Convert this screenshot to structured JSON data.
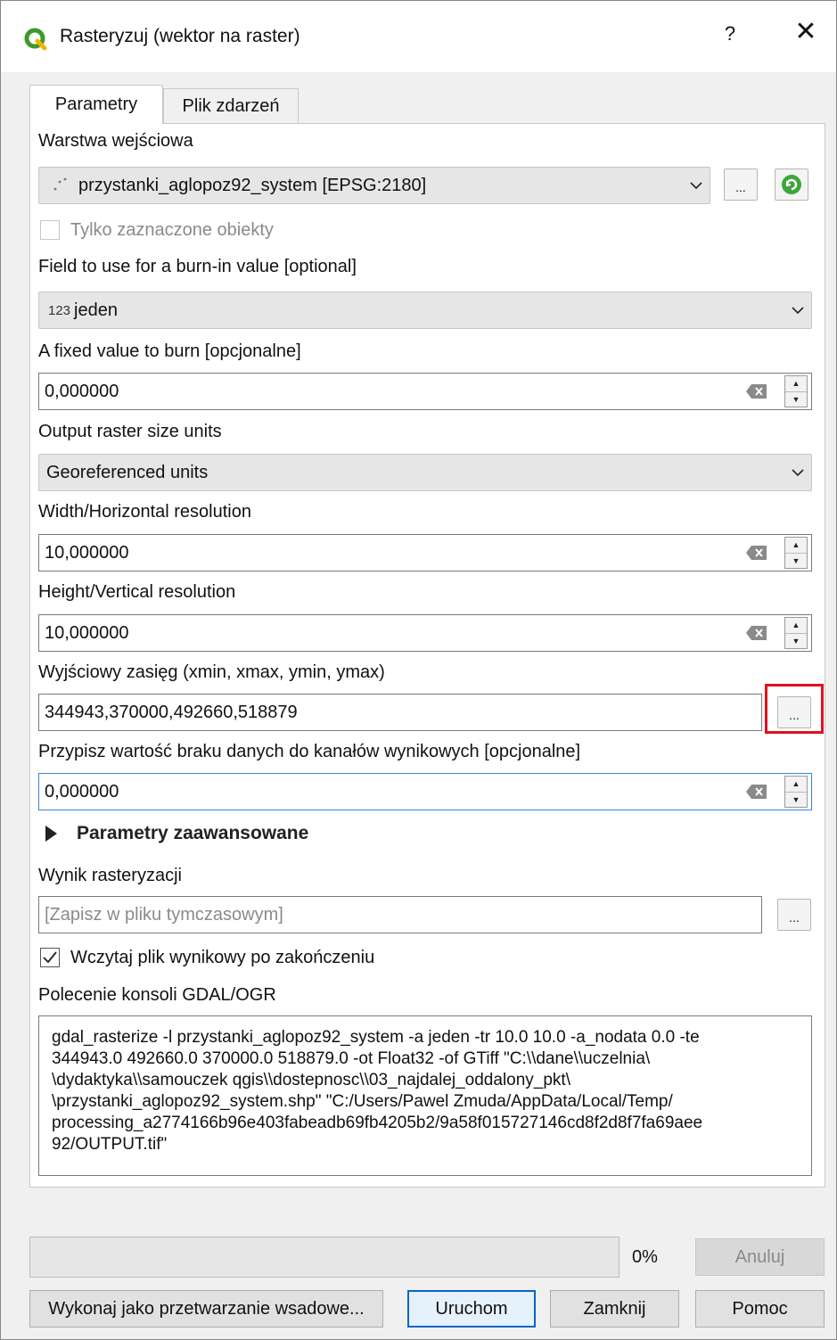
{
  "window": {
    "title": "Rasteryzuj (wektor na raster)",
    "help": "?",
    "close": "✕",
    "accent_color": "#3c9a2d"
  },
  "tabs": [
    {
      "label": "Parametry",
      "active": true
    },
    {
      "label": "Plik zdarzeń",
      "active": false
    }
  ],
  "input_layer": {
    "label": "Warstwa wejściowa",
    "value": "przystanki_aglopoz92_system [EPSG:2180]",
    "browse": "...",
    "selected_only_label": "Tylko zaznaczone obiekty",
    "selected_only_checked": false
  },
  "burn_field": {
    "label": "Field to use for a burn-in value [optional]",
    "type_prefix": "123",
    "value": "jeden"
  },
  "fixed_value": {
    "label": "A fixed value to burn [opcjonalne]",
    "value": "0,000000"
  },
  "size_units": {
    "label": "Output raster size units",
    "value": "Georeferenced units"
  },
  "width_res": {
    "label": "Width/Horizontal resolution",
    "value": "10,000000"
  },
  "height_res": {
    "label": "Height/Vertical resolution",
    "value": "10,000000"
  },
  "extent": {
    "label": "Wyjściowy zasięg (xmin, xmax, ymin, ymax)",
    "value": "344943,370000,492660,518879",
    "browse": "..."
  },
  "nodata": {
    "label": "Przypisz wartość braku danych do kanałów wynikowych [opcjonalne]",
    "value": "0,000000"
  },
  "advanced": {
    "label": "Parametry zaawansowane"
  },
  "output": {
    "label": "Wynik rasteryzacji",
    "placeholder": "[Zapisz w pliku tymczasowym]",
    "browse": "...",
    "open_label": "Wczytaj plik wynikowy po zakończeniu",
    "open_checked": true
  },
  "console": {
    "label": "Polecenie konsoli GDAL/OGR",
    "text": "gdal_rasterize -l przystanki_aglopoz92_system -a jeden -tr 10.0 10.0 -a_nodata 0.0 -te\n344943.0 492660.0 370000.0 518879.0 -ot Float32 -of GTiff \"C:\\\\dane\\\\uczelnia\\\n\\dydaktyka\\\\samouczek qgis\\\\dostepnosc\\\\03_najdalej_oddalony_pkt\\\n\\przystanki_aglopoz92_system.shp\" \"C:/Users/Pawel Zmuda/AppData/Local/Temp/\nprocessing_a2774166b96e403fabeadb69fb4205b2/9a58f015727146cd8f2d8f7fa69aee\n92/OUTPUT.tif\""
  },
  "footer": {
    "progress": 0,
    "progress_text": "0%",
    "cancel": "Anuluj",
    "batch": "Wykonaj jako przetwarzanie wsadowe...",
    "run": "Uruchom",
    "close": "Zamknij",
    "help": "Pomoc"
  }
}
